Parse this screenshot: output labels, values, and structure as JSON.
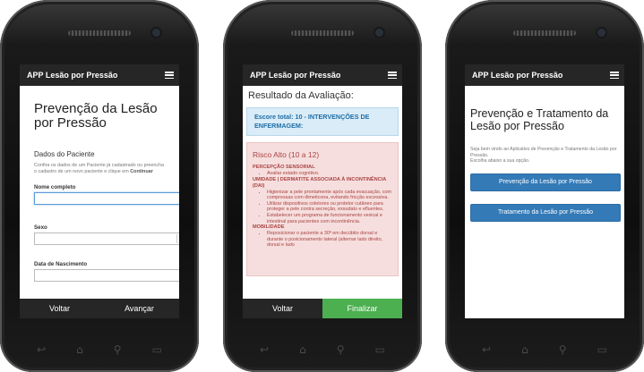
{
  "phones": [
    {
      "app_title": "APP Lesão por Pressão",
      "heading": "Prevenção da Lesão por Pressão",
      "section_title": "Dados do Paciente",
      "note_text": "Confira os dados de um Paciente já cadastrado ou preencha o cadastro de um novo paciente e clique em",
      "note_link": "Continuar",
      "fields": {
        "name_label": "Nome completo",
        "sex_label": "Sexo",
        "birth_label": "Data de Nascimento"
      },
      "bottom": {
        "back": "Voltar",
        "next": "Avançar"
      }
    },
    {
      "app_title": "APP Lesão por Pressão",
      "result_title": "Resultado da Avaliação:",
      "score_text": "Escore total: 10 - INTERVENÇÕES DE ENFERMAGEM:",
      "risk_title": "Risco Alto (10 a 12)",
      "sections": {
        "s1_title": "PERCEPÇÃO SENSORIAL",
        "s1_items": [
          "Avaliar estado cognitivo."
        ],
        "s2_title": "UMIDADE | DERMATITE ASSOCIADA À INCONTINÊNCIA (DAI)",
        "s2_items": [
          "Higienizar a pele prontamente após cada evacuação, com compressas com dimeticona, evitando fricção excessiva.",
          "Utilizar dispositivos coletores ou protetor cutâneo para proteger a pele contra secreção, exsudato e efluentes.",
          "Estabelecer um programa de funcionamento vesical e intestinal para pacientes com incontinência."
        ],
        "s3_title": "MOBILIDADE",
        "s3_items": [
          "Reposicionar o paciente a 30º em decúbito dorsal e durante o posicionamento lateral (alternar lado direito, dorsal e lado"
        ]
      },
      "bottom": {
        "back": "Voltar",
        "finish": "Finalizar"
      }
    },
    {
      "app_title": "APP Lesão por Pressão",
      "heading": "Prevenção e Tratamento da Lesão por Pressão",
      "intro_line1": "Seja bem vindo ao Aplicativo de Prevenção e Tratamento da Lesão por Pressão.",
      "intro_line2": "Escolha abaixo a sua opção.",
      "button_prevention": "Prevenção da Lesão por Pressão",
      "button_treatment": "Tratamento da Lesão por Pressão"
    }
  ],
  "nav_icons": [
    "back-icon",
    "home-icon",
    "search-icon",
    "recent-apps-icon"
  ],
  "colors": {
    "appbar": "#262626",
    "primary_button": "#337ab7",
    "finish_button": "#4caf50",
    "risk_panel": "#f6dede",
    "score_panel": "#d9ecf7"
  }
}
